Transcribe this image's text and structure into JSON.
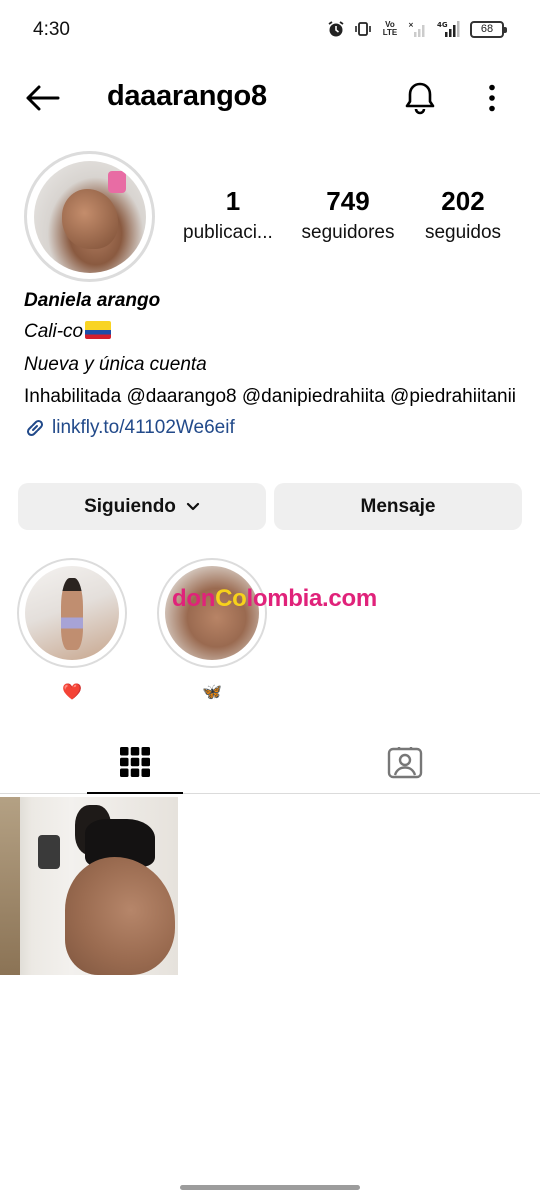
{
  "status_bar": {
    "time": "4:30",
    "battery": "68",
    "network": "4G",
    "volte": "Vo LTE"
  },
  "header": {
    "username": "daaarango8",
    "icons": [
      "back-arrow-icon",
      "bell-icon",
      "more-vertical-icon"
    ]
  },
  "profile": {
    "stats": {
      "posts_count": "1",
      "posts_label": "publicaci...",
      "followers_count": "749",
      "followers_label": "seguidores",
      "following_count": "202",
      "following_label": "seguidos"
    },
    "bio": {
      "name": "Daniela arango",
      "line1": "Cali-co",
      "line2": "Nueva y única cuenta",
      "line3": "Inhabilitada @daarango8 @danipiedrahiita @piedrahiitanii",
      "link": "linkfly.to/41102We6eif"
    }
  },
  "actions": {
    "following_label": "Siguiendo",
    "message_label": "Mensaje"
  },
  "highlights": [
    {
      "label": "❤️"
    },
    {
      "label": "🦋"
    }
  ],
  "watermark": {
    "part1": "don",
    "part2": "Co",
    "part3": "lombia.com"
  },
  "tabs": [
    {
      "name": "grid",
      "icon": "grid-icon",
      "active": true
    },
    {
      "name": "tagged",
      "icon": "tagged-person-icon",
      "active": false
    }
  ],
  "colors": {
    "link": "#224a8a",
    "button_bg": "#efefef",
    "watermark_pink": "#e0227a",
    "watermark_yellow": "#f7d21b"
  }
}
